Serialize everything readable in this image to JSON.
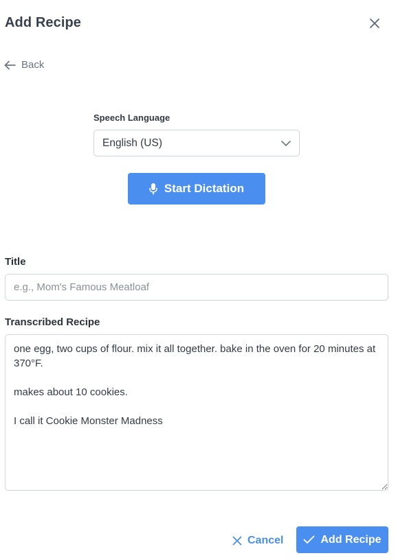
{
  "header": {
    "title": "Add Recipe"
  },
  "navigation": {
    "back_label": "Back"
  },
  "speech": {
    "language_label": "Speech Language",
    "language_selected": "English (US)",
    "dictation_label": "Start Dictation"
  },
  "form": {
    "title_label": "Title",
    "title_placeholder": "e.g., Mom's Famous Meatloaf",
    "title_value": "",
    "recipe_label": "Transcribed Recipe",
    "recipe_value": "one egg, two cups of flour. mix it all together. bake in the oven for 20 minutes at 370°F.\n\nmakes about 10 cookies.\n\nI call it Cookie Monster Madness"
  },
  "actions": {
    "cancel_label": "Cancel",
    "submit_label": "Add Recipe"
  },
  "icons": {
    "close": "close-icon",
    "back": "arrow-left-icon",
    "dropdown": "chevron-down-icon",
    "microphone": "microphone-icon",
    "cancel": "x-icon",
    "submit": "check-icon"
  },
  "colors": {
    "accent": "#4a8ef0",
    "heading": "#37404f",
    "muted": "#6b7480",
    "border": "#cfd4da"
  }
}
